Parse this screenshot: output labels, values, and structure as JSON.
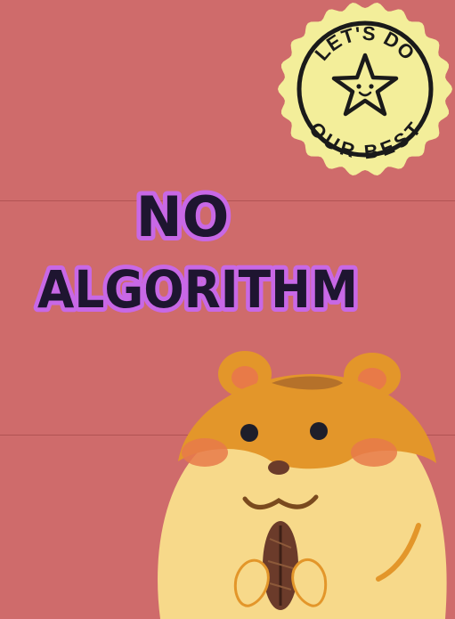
{
  "poster": {
    "title_line1": "NO",
    "title_line2": "ALGORITHM",
    "badge_top": "LET'S DO",
    "badge_bottom": "OUR BEST",
    "badge_icon": "smiling-star-icon",
    "mascot": "hamster-holding-seed",
    "colors": {
      "background": "#cf6b6b",
      "title_fill": "#1e1530",
      "title_outline": "#c868e6",
      "badge_fill": "#f3ee9a",
      "badge_ink": "#1a1a1a",
      "fur_orange": "#e3962a",
      "fur_cream": "#f7d98a",
      "cheek": "#e77a4a",
      "seed": "#6b3b2a"
    }
  }
}
